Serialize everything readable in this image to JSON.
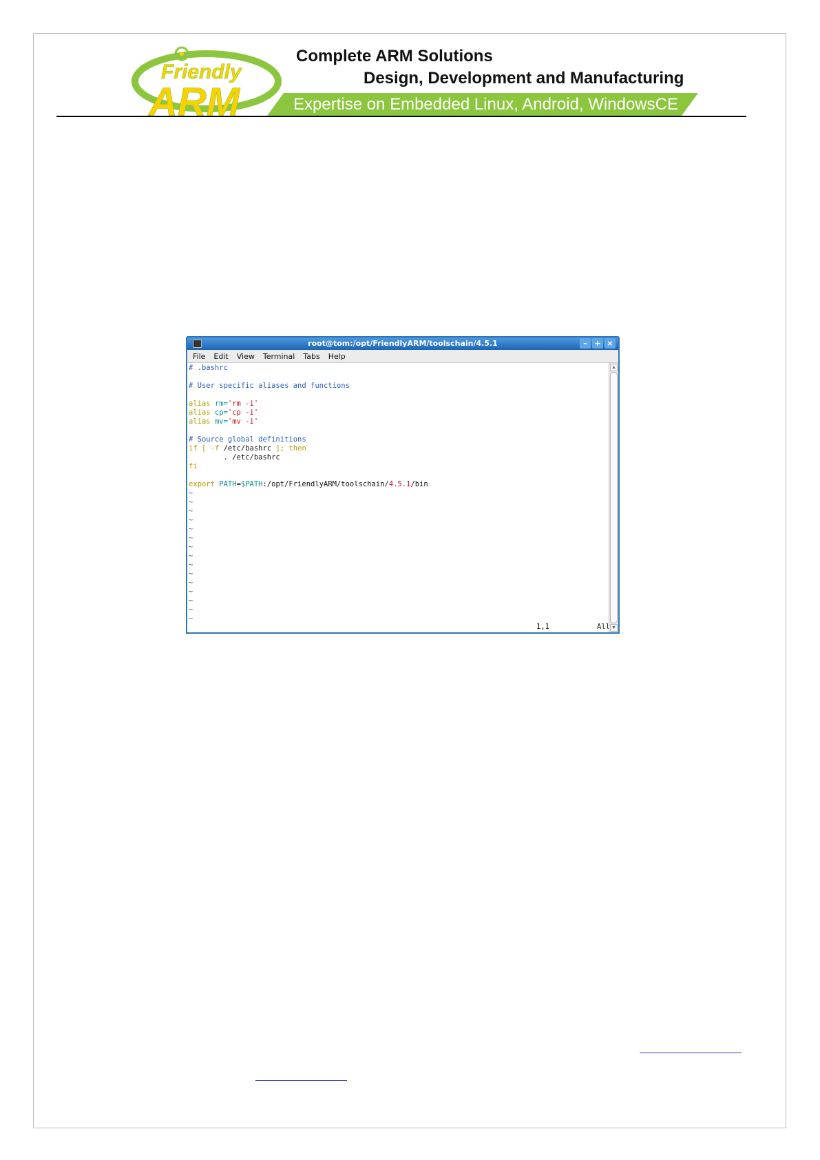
{
  "header": {
    "logo_word_top": "Friendly",
    "logo_word_bottom": "ARM",
    "tagline_line1": "Complete ARM Solutions",
    "tagline_line2": "Design, Development and  Manufacturing",
    "banner_text": "Expertise on Embedded Linux, Android, WindowsCE",
    "colors": {
      "logo_green": "#8cc63e",
      "logo_yellow": "#f7d200",
      "banner_green": "#8cc63e"
    }
  },
  "terminal": {
    "title": "root@tom:/opt/FriendlyARM/toolschain/4.5.1",
    "window_buttons": [
      "–",
      "+",
      "×"
    ],
    "menu": [
      "File",
      "Edit",
      "View",
      "Terminal",
      "Tabs",
      "Help"
    ],
    "lines": {
      "l1": "# .bashrc",
      "l3": "# User specific aliases and functions",
      "alias_kw": "alias",
      "rm_name": "rm=",
      "rm_val": "'rm -i'",
      "cp_name": "cp=",
      "cp_val": "'cp -i'",
      "mv_name": "mv=",
      "mv_val": "'mv -i'",
      "src_comment": "# Source global definitions",
      "if_kw": "if",
      "if_open": "[ -f",
      "if_path": "/etc/bashrc",
      "if_close": "];",
      "then_kw": "then",
      "dot_src": "        . /etc/bashrc",
      "fi_kw": "fi",
      "export_kw": "export",
      "path_var": "PATH",
      "path_eq": "=",
      "dollar_path": "$PATH",
      "path_prefix": ":/opt/FriendlyARM/toolschain/",
      "path_ver": "4.5.1",
      "path_suffix": "/bin",
      "tilde": "~"
    },
    "status_position": "1,1",
    "status_all": "All"
  }
}
